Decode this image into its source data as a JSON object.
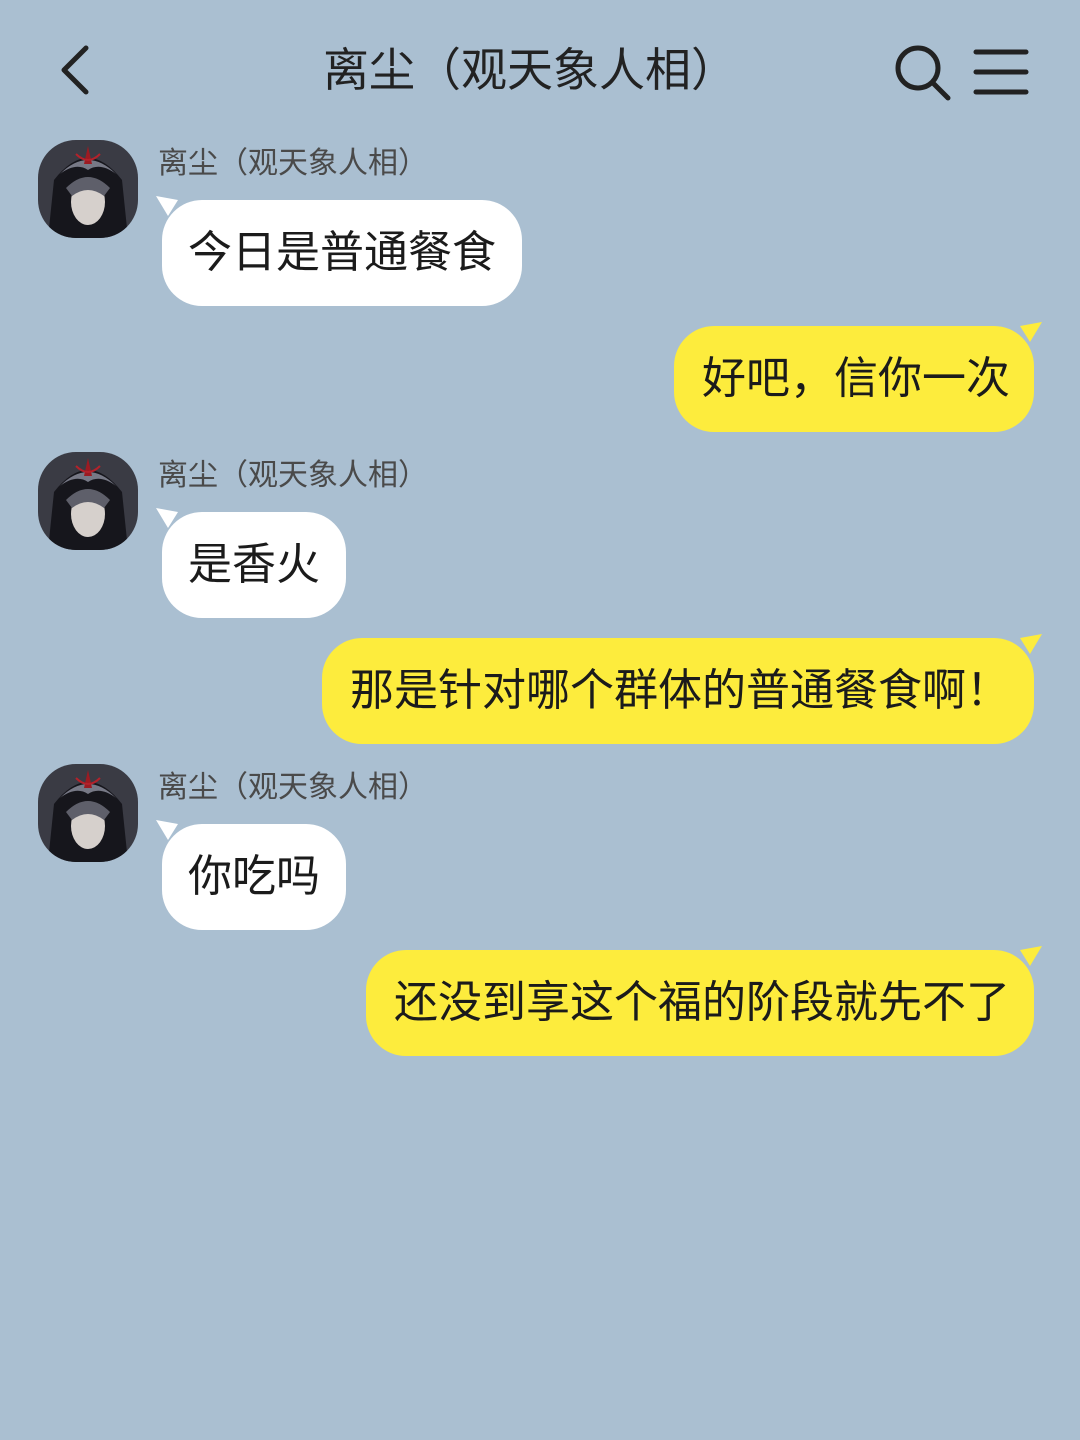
{
  "header": {
    "title": "离尘（观天象人相）",
    "back_icon": "chevron-left-icon",
    "search_icon": "search-icon",
    "menu_icon": "hamburger-menu-icon"
  },
  "colors": {
    "background": "#aabfd1",
    "incoming_bubble": "#ffffff",
    "outgoing_bubble": "#fdec3d"
  },
  "messages": [
    {
      "direction": "incoming",
      "sender": "离尘（观天象人相）",
      "text": "今日是普通餐食"
    },
    {
      "direction": "outgoing",
      "text": "好吧，信你一次"
    },
    {
      "direction": "incoming",
      "sender": "离尘（观天象人相）",
      "text": "是香火"
    },
    {
      "direction": "outgoing",
      "text": "那是针对哪个群体的普通餐食啊！"
    },
    {
      "direction": "incoming",
      "sender": "离尘（观天象人相）",
      "text": "你吃吗"
    },
    {
      "direction": "outgoing",
      "text": "还没到享这个福的阶段就先不了"
    }
  ]
}
